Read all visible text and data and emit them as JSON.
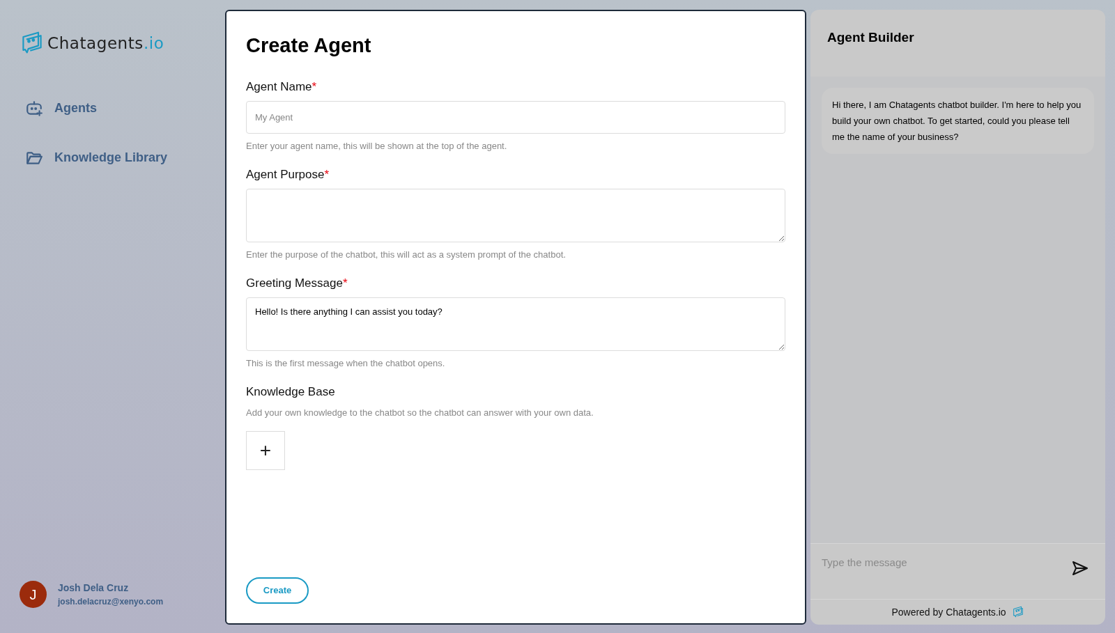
{
  "sidebar": {
    "logo": {
      "name": "Chatagents",
      "suffix": ".io"
    },
    "items": [
      {
        "label": "Agents"
      },
      {
        "label": "Knowledge Library"
      }
    ],
    "user": {
      "initial": "J",
      "name": "Josh Dela Cruz",
      "email": "josh.delacruz@xenyo.com"
    }
  },
  "form": {
    "title": "Create Agent",
    "fields": [
      {
        "kind": "input",
        "label": "Agent Name",
        "required_mark": "*",
        "placeholder": "My Agent",
        "hint": "Enter your agent name, this will be shown at the top of the agent."
      },
      {
        "kind": "textarea",
        "label": "Agent Purpose",
        "required_mark": "*",
        "hint": "Enter the purpose of the chatbot, this will act as a system prompt of the chatbot."
      },
      {
        "kind": "textarea",
        "label": "Greeting Message",
        "required_mark": "*",
        "value": "Hello! Is there anything I can assist you today?",
        "hint": "This is the first message when the chatbot opens."
      }
    ],
    "knowledge": {
      "label": "Knowledge Base",
      "hint": "Add your own knowledge to the chatbot so the chatbot can answer with your own data.",
      "add": "+"
    },
    "submit": "Create"
  },
  "chat": {
    "title": "Agent Builder",
    "messages": [
      "Hi there, I am Chatagents chatbot builder. I'm here to help you build your own chatbot. To get started, could you please tell me the name of your business?"
    ],
    "input_placeholder": "Type the message",
    "footer": "Powered by Chatagents.io"
  }
}
